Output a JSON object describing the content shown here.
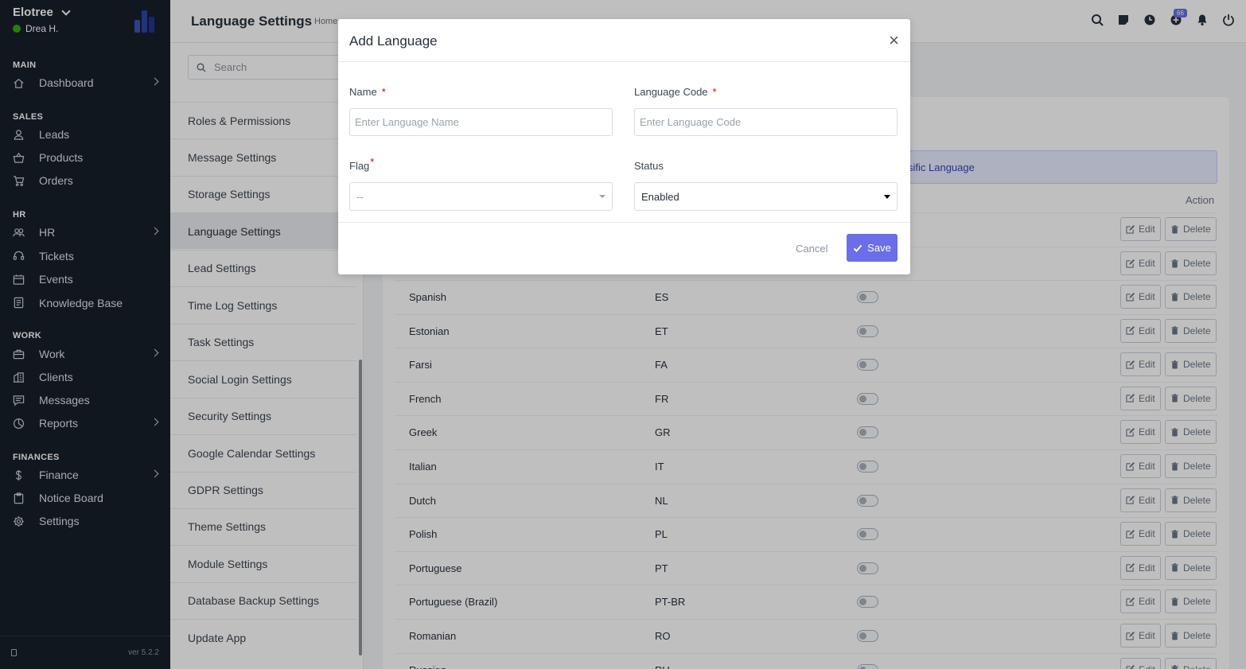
{
  "sidebar": {
    "company": "Elotree",
    "user": "Drea H.",
    "sections": [
      {
        "title": "MAIN",
        "items": [
          {
            "label": "Dashboard",
            "icon": "home-icon",
            "arrow": true
          }
        ]
      },
      {
        "title": "SALES",
        "items": [
          {
            "label": "Leads",
            "icon": "user-icon",
            "arrow": false
          },
          {
            "label": "Products",
            "icon": "basket-icon",
            "arrow": false
          },
          {
            "label": "Orders",
            "icon": "cart-icon",
            "arrow": false
          }
        ]
      },
      {
        "title": "HR",
        "items": [
          {
            "label": "HR",
            "icon": "people-icon",
            "arrow": true
          },
          {
            "label": "Tickets",
            "icon": "headset-icon",
            "arrow": false
          },
          {
            "label": "Events",
            "icon": "calendar-icon",
            "arrow": false
          },
          {
            "label": "Knowledge Base",
            "icon": "book-icon",
            "arrow": false
          }
        ]
      },
      {
        "title": "WORK",
        "items": [
          {
            "label": "Work",
            "icon": "briefcase-icon",
            "arrow": true
          },
          {
            "label": "Clients",
            "icon": "building-icon",
            "arrow": false
          },
          {
            "label": "Messages",
            "icon": "message-icon",
            "arrow": false
          },
          {
            "label": "Reports",
            "icon": "pie-chart-icon",
            "arrow": true
          }
        ]
      },
      {
        "title": "FINANCES",
        "items": [
          {
            "label": "Finance",
            "icon": "dollar-icon",
            "arrow": true
          },
          {
            "label": "Notice Board",
            "icon": "clipboard-icon",
            "arrow": false
          },
          {
            "label": "Settings",
            "icon": "gear-icon",
            "arrow": false
          }
        ]
      }
    ],
    "version": "ver 5.2.2"
  },
  "header": {
    "title": "Language Settings",
    "breadcrumb": "Home",
    "notification_count": "66",
    "icons": [
      "search-icon",
      "sticky-note-icon",
      "clock-icon",
      "plus-circle-icon",
      "bell-icon",
      "power-icon"
    ]
  },
  "settings_menu": {
    "search_placeholder": "Search",
    "items": [
      "Roles & Permissions",
      "Message Settings",
      "Storage Settings",
      "Language Settings",
      "Lead Settings",
      "Time Log Settings",
      "Task Settings",
      "Social Login Settings",
      "Security Settings",
      "Google Calendar Settings",
      "GDPR Settings",
      "Theme Settings",
      "Module Settings",
      "Database Backup Settings",
      "Update App"
    ],
    "active": "Language Settings"
  },
  "content": {
    "info_text": "sific Language",
    "action_header": "Action",
    "edit_label": "Edit",
    "delete_label": "Delete",
    "languages": [
      {
        "name": "Spanish",
        "code": "ES"
      },
      {
        "name": "Estonian",
        "code": "ET"
      },
      {
        "name": "Farsi",
        "code": "FA"
      },
      {
        "name": "French",
        "code": "FR"
      },
      {
        "name": "Greek",
        "code": "GR"
      },
      {
        "name": "Italian",
        "code": "IT"
      },
      {
        "name": "Dutch",
        "code": "NL"
      },
      {
        "name": "Polish",
        "code": "PL"
      },
      {
        "name": "Portuguese",
        "code": "PT"
      },
      {
        "name": "Portuguese (Brazil)",
        "code": "PT-BR"
      },
      {
        "name": "Romanian",
        "code": "RO"
      },
      {
        "name": "Russian",
        "code": "RU"
      }
    ]
  },
  "modal": {
    "title": "Add Language",
    "name_label": "Name",
    "name_placeholder": "Enter Language Name",
    "code_label": "Language Code",
    "code_placeholder": "Enter Language Code",
    "flag_label": "Flag",
    "flag_value": "--",
    "status_label": "Status",
    "status_value": "Enabled",
    "cancel_label": "Cancel",
    "save_label": "Save",
    "required_mark": "*"
  },
  "colors": {
    "sidebar_bg": "#171f29",
    "accent": "#6a6ee8",
    "status_online": "#2cb100",
    "required": "#d30000"
  }
}
